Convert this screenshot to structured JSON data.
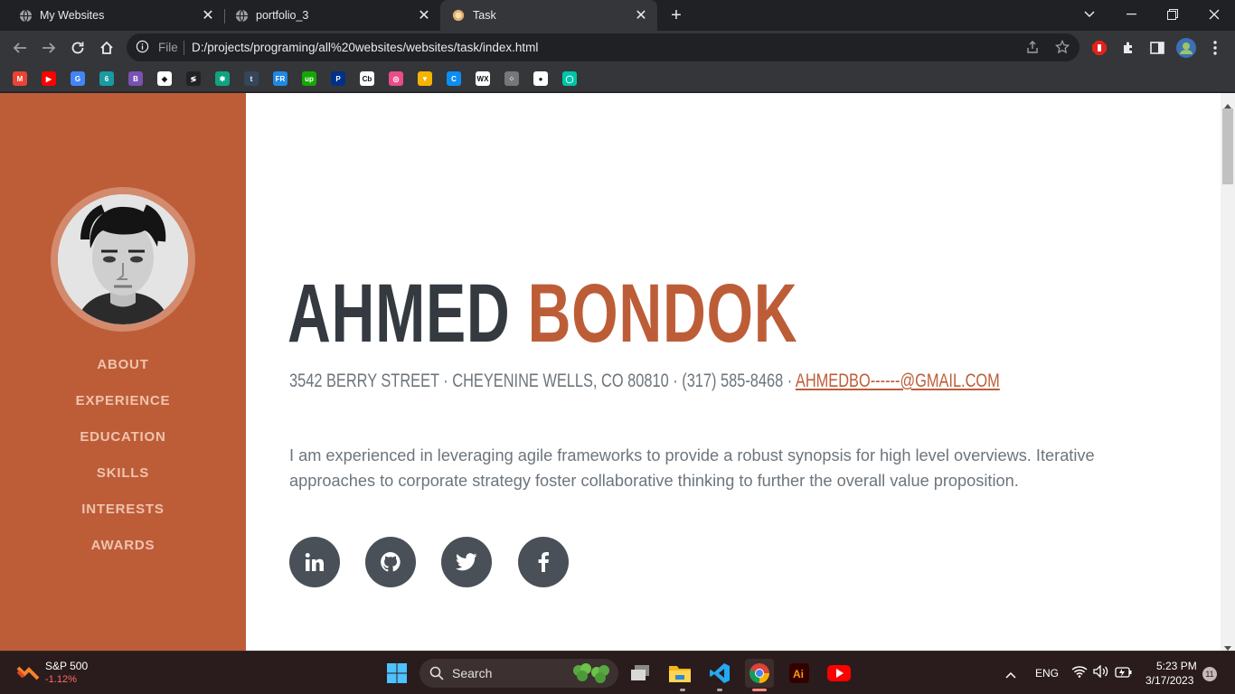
{
  "browser": {
    "tabs": [
      {
        "title": "My Websites"
      },
      {
        "title": "portfolio_3"
      },
      {
        "title": "Task"
      }
    ],
    "omnibox": {
      "scheme_label": "File",
      "url": "D:/projects/programing/all%20websites/websites/task/index.html"
    }
  },
  "bookmarks": [
    {
      "icon": "gmail-icon",
      "color": "#ea4335",
      "text": "M"
    },
    {
      "icon": "youtube-icon",
      "color": "#ff0000",
      "text": "▶"
    },
    {
      "icon": "google-translate-icon",
      "color": "#4285f4",
      "text": "G"
    },
    {
      "icon": "bookmark-teal-icon",
      "color": "#1a9ba3",
      "text": "6"
    },
    {
      "icon": "bootstrap-icon",
      "color": "#7952b3",
      "text": "B"
    },
    {
      "icon": "codepen-icon",
      "color": "#ffffff",
      "text": "◆"
    },
    {
      "icon": "bookmark-dark-icon",
      "color": "#222222",
      "text": "≶"
    },
    {
      "icon": "chatgpt-icon",
      "color": "#10a37f",
      "text": "✱"
    },
    {
      "icon": "tumblr-icon",
      "color": "#35465c",
      "text": "t"
    },
    {
      "icon": "bookmark-fr-icon",
      "color": "#1e88e5",
      "text": "FR"
    },
    {
      "icon": "upwork-icon",
      "color": "#14a800",
      "text": "up"
    },
    {
      "icon": "paypal-icon",
      "color": "#003087",
      "text": "P"
    },
    {
      "icon": "crunchbase-icon",
      "color": "#ffffff",
      "text": "Cb"
    },
    {
      "icon": "dribbble-icon",
      "color": "#ea4c89",
      "text": "◎"
    },
    {
      "icon": "bookmark-shield-icon",
      "color": "#f4b400",
      "text": "▼"
    },
    {
      "icon": "bookmark-c-icon",
      "color": "#0b8ef3",
      "text": "C"
    },
    {
      "icon": "wix-icon",
      "color": "#ffffff",
      "text": "WX"
    },
    {
      "icon": "bookmark-dots-icon",
      "color": "#777777",
      "text": "⁘"
    },
    {
      "icon": "github-icon",
      "color": "#ffffff",
      "text": "●"
    },
    {
      "icon": "bookmark-ring-icon",
      "color": "#00c4a7",
      "text": "◯"
    }
  ],
  "sidebar": {
    "nav": [
      "About",
      "Experience",
      "Education",
      "Skills",
      "Interests",
      "Awards"
    ]
  },
  "profile": {
    "first_name": "AHMED",
    "last_name": "BONDOK",
    "address": "3542 BERRY STREET · CHEYENINE WELLS, CO 80810 · (317) 585-8468 · ",
    "email": "AHMEDBO------@GMAIL.COM",
    "bio": "I am experienced in leveraging agile frameworks to provide a robust synopsis for high level overviews. Iterative approaches to corporate strategy foster collaborative thinking to further the overall value proposition.",
    "socials": [
      "linkedin-icon",
      "github-icon",
      "twitter-icon",
      "facebook-icon"
    ]
  },
  "colors": {
    "accent": "#bd5d38",
    "dark": "#343a40",
    "muted": "#6c757d",
    "social_bg": "#495057"
  },
  "taskbar": {
    "stock_name": "S&P 500",
    "stock_change": "-1.12%",
    "search_label": "Search",
    "language": "ENG",
    "time": "5:23 PM",
    "date": "3/17/2023",
    "notifications": "11"
  }
}
